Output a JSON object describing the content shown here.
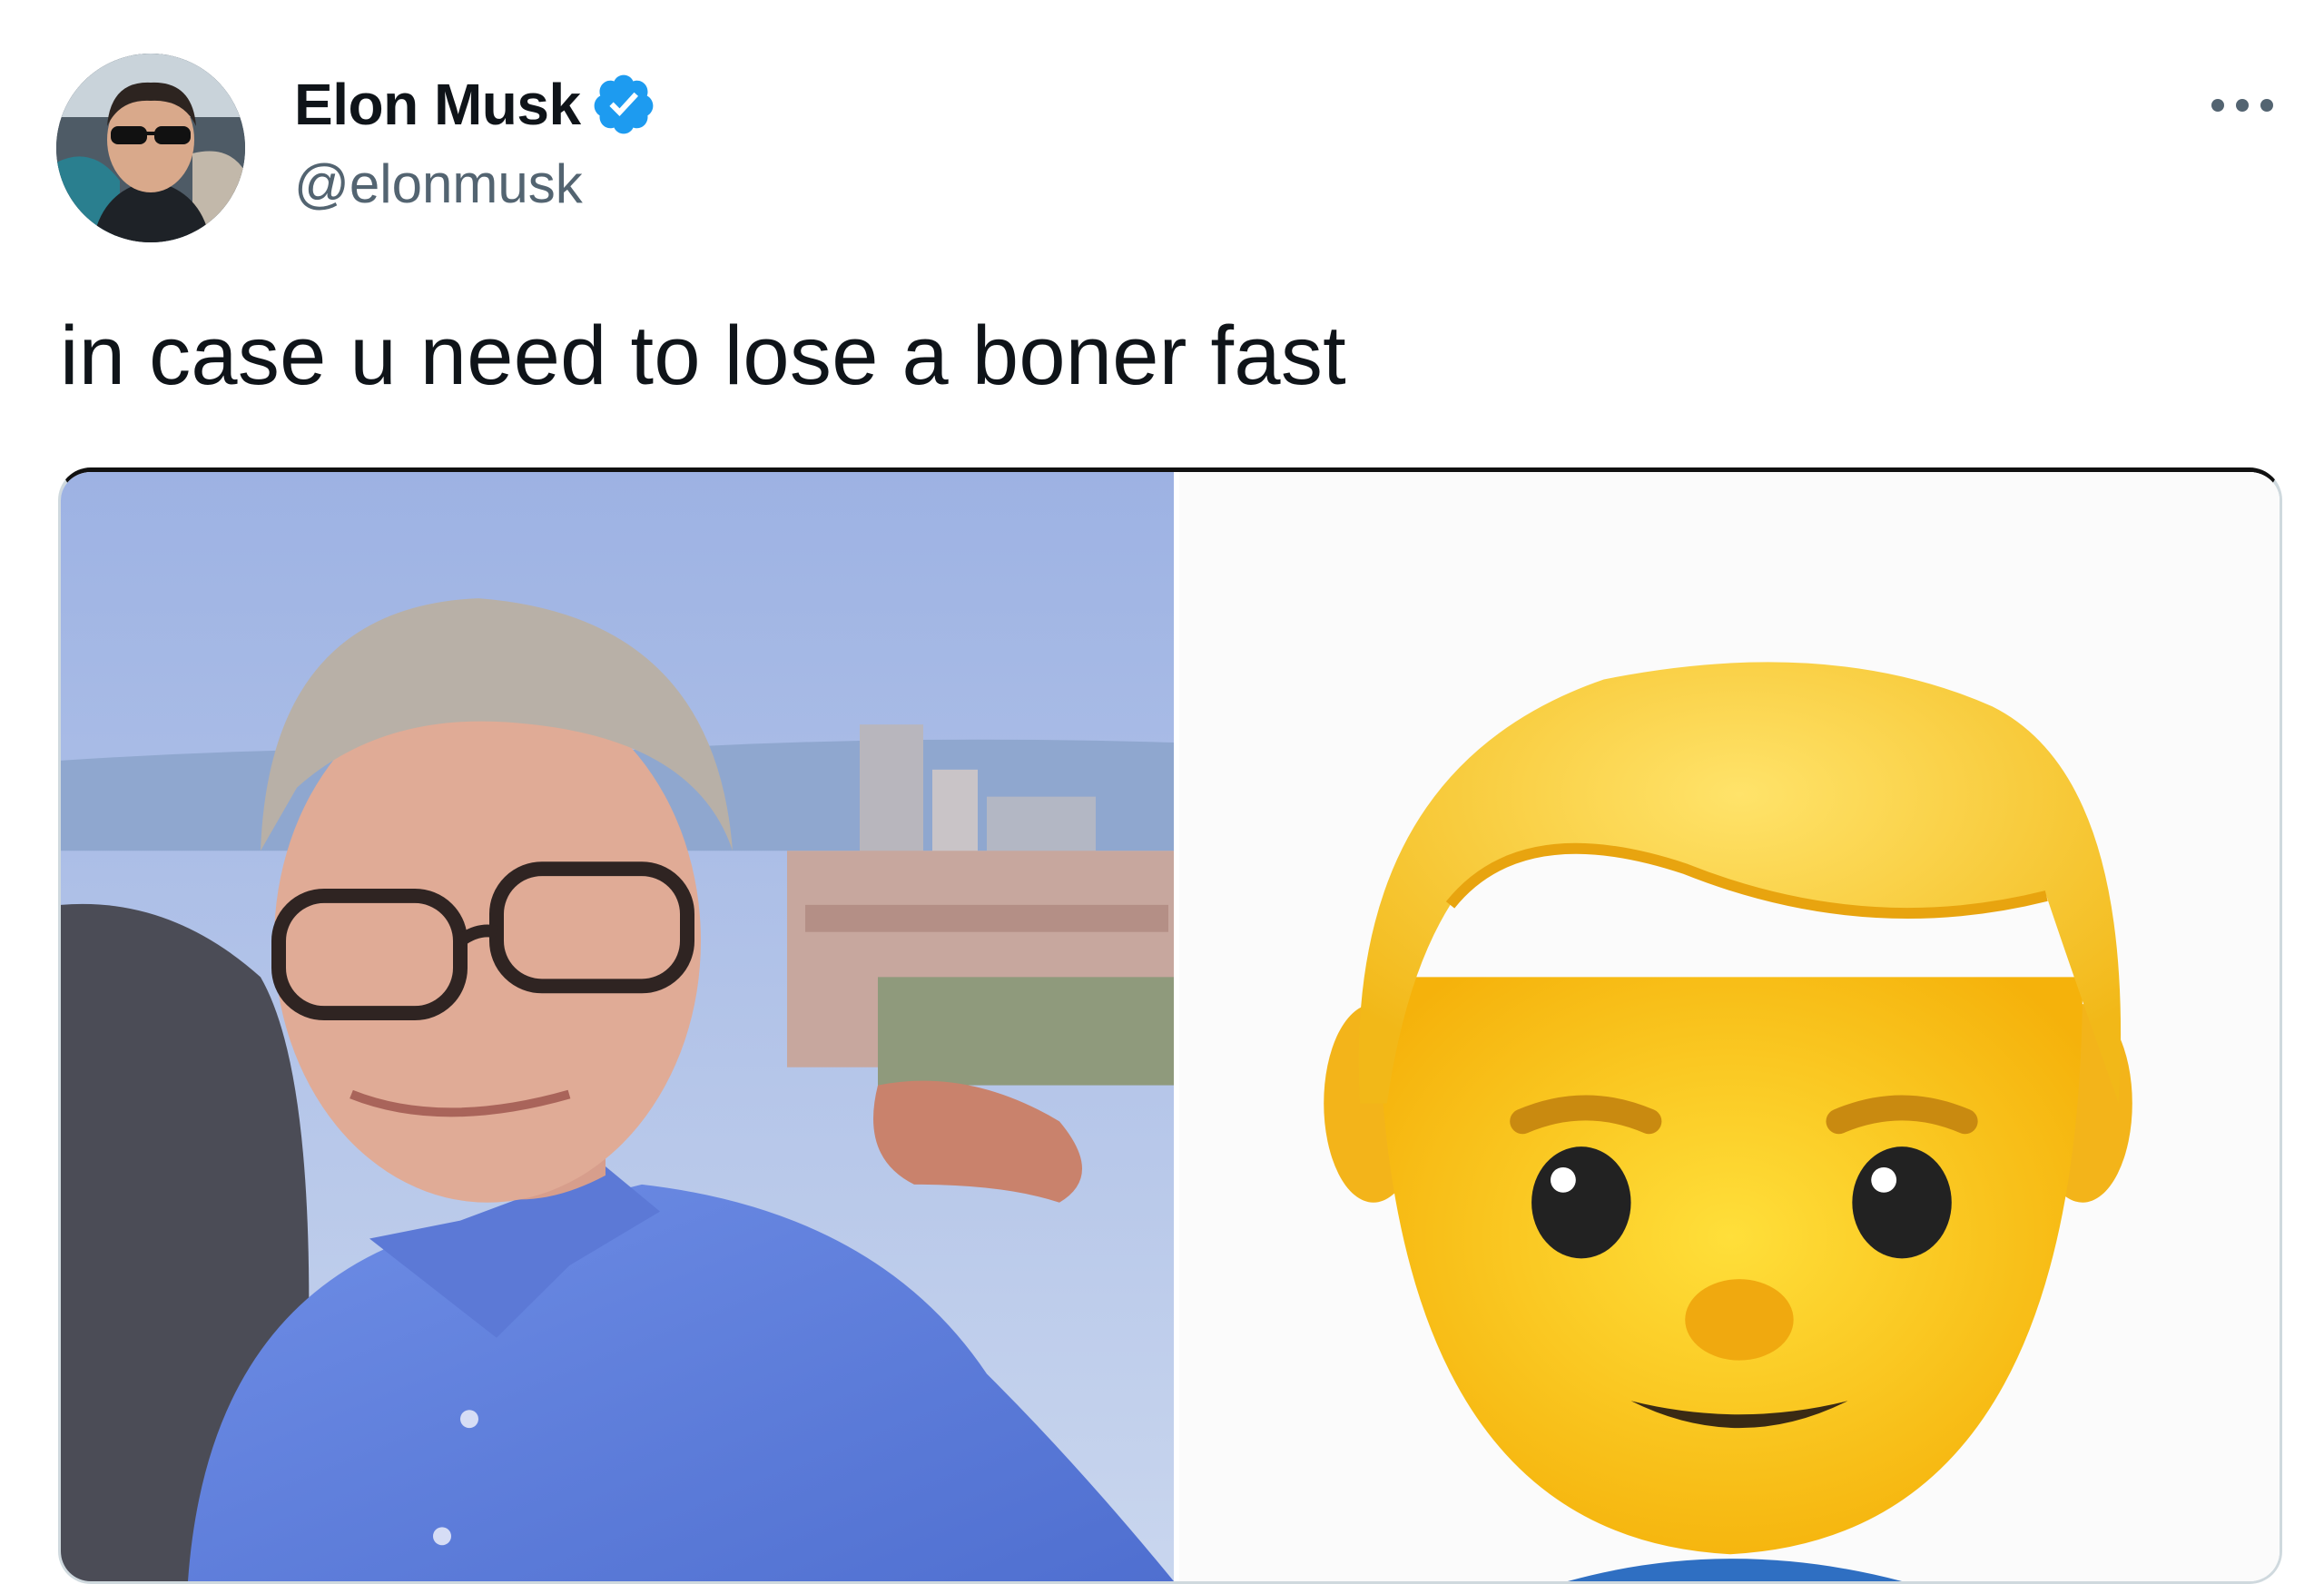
{
  "tweet": {
    "author": {
      "display_name": "Elon Musk",
      "handle": "@elonmusk",
      "verified": true,
      "avatar": "avatar-photo"
    },
    "more_icon": "more-horizontal-icon",
    "text": "in case u need to lose a boner fast",
    "media": [
      {
        "kind": "photo",
        "subject": "man-in-blue-shirt-photo"
      },
      {
        "kind": "photo",
        "subject": "man-emoji-image"
      }
    ]
  },
  "colors": {
    "text_primary": "#0f1419",
    "text_secondary": "#536471",
    "verified_blue": "#1d9bf0",
    "border": "#cfd9de"
  }
}
